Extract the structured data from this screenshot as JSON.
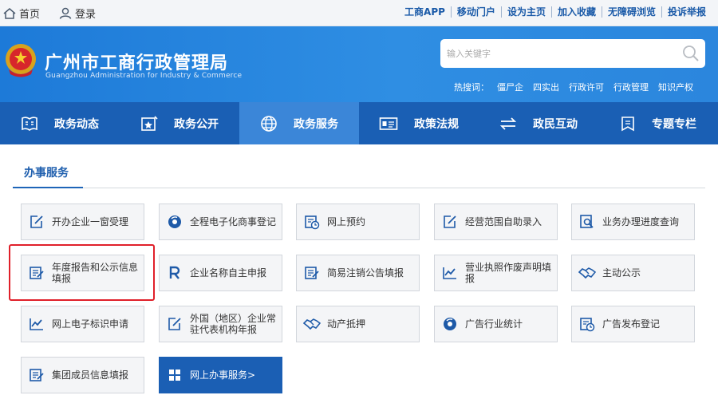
{
  "topbar": {
    "home": "首页",
    "login": "登录",
    "links": [
      "工商APP",
      "移动门户",
      "设为主页",
      "加入收藏",
      "无障碍浏览",
      "投诉举报"
    ]
  },
  "header": {
    "title": "广州市工商行政管理局",
    "subtitle": "Guangzhou Administration for Industry & Commerce",
    "search_placeholder": "输入关键字",
    "hot_label": "热搜词：",
    "hot_keywords": [
      "僵尸企",
      "四实出",
      "行政许可",
      "行政管理",
      "知识产权"
    ]
  },
  "nav": [
    {
      "label": "政务动态",
      "icon": "news-icon"
    },
    {
      "label": "政务公开",
      "icon": "publish-icon"
    },
    {
      "label": "政务服务",
      "icon": "globe-icon"
    },
    {
      "label": "政策法规",
      "icon": "id-card-icon"
    },
    {
      "label": "政民互动",
      "icon": "exchange-icon"
    },
    {
      "label": "专题专栏",
      "icon": "bookmark-icon"
    }
  ],
  "section": {
    "title": "办事服务"
  },
  "services": [
    {
      "label": "开办企业一窗受理",
      "icon": "edit-doc-icon"
    },
    {
      "label": "全程电子化商事登记",
      "icon": "disc-icon"
    },
    {
      "label": "网上预约",
      "icon": "calendar-clock-icon"
    },
    {
      "label": "经营范围自助录入",
      "icon": "edit-doc-icon"
    },
    {
      "label": "业务办理进度查询",
      "icon": "search-doc-icon"
    },
    {
      "label": "年度报告和公示信息填报",
      "icon": "form-edit-icon"
    },
    {
      "label": "企业名称自主申报",
      "icon": "letter-r-icon"
    },
    {
      "label": "简易注销公告填报",
      "icon": "form-edit-icon"
    },
    {
      "label": "营业执照作废声明填报",
      "icon": "chart-doc-icon"
    },
    {
      "label": "主动公示",
      "icon": "handshake-icon"
    },
    {
      "label": "网上电子标识申请",
      "icon": "chart-doc-icon"
    },
    {
      "label": "外国（地区）企业常驻代表机构年报",
      "icon": "edit-doc-icon"
    },
    {
      "label": "动产抵押",
      "icon": "handshake-icon"
    },
    {
      "label": "广告行业统计",
      "icon": "disc-icon"
    },
    {
      "label": "广告发布登记",
      "icon": "calendar-clock-icon"
    },
    {
      "label": "集团成员信息填报",
      "icon": "form-edit-icon"
    },
    {
      "label": "网上办事服务>",
      "icon": "grid-icon"
    }
  ]
}
